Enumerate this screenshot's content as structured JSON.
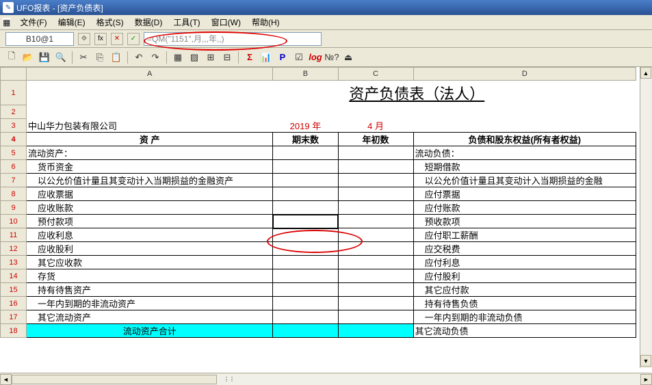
{
  "title": "UFO报表 - [资产负债表]",
  "menu": [
    "文件(F)",
    "编辑(E)",
    "格式(S)",
    "数据(D)",
    "工具(T)",
    "窗口(W)",
    "帮助(H)"
  ],
  "cell_ref": "B10@1",
  "formula": "=QM(\"1151\",月,,,年,,)",
  "toolbar": {
    "sigma": "Σ",
    "p": "P",
    "log": "log",
    "help": "?"
  },
  "cols": [
    "A",
    "B",
    "C",
    "D"
  ],
  "sheet_title": "资产负债表（法人）",
  "row3": {
    "company": "中山华力包装有限公司",
    "year": "2019 年",
    "month": "4 月"
  },
  "row4": {
    "a": "资    产",
    "b": "期末数",
    "c": "年初数",
    "d": "负债和股东权益(所有者权益)"
  },
  "rows": [
    {
      "n": 5,
      "a": "流动资产：",
      "d": "流动负债：",
      "indent": 0
    },
    {
      "n": 6,
      "a": "货币资金",
      "d": "短期借款",
      "indent": 1
    },
    {
      "n": 7,
      "a": "以公允价值计量且其变动计入当期损益的金融资产",
      "d": "以公允价值计量且其变动计入当期损益的金融",
      "indent": 1
    },
    {
      "n": 8,
      "a": "应收票据",
      "d": "应付票据",
      "indent": 1
    },
    {
      "n": 9,
      "a": "应收账款",
      "d": "应付账款",
      "indent": 1
    },
    {
      "n": 10,
      "a": "预付款项",
      "d": "预收款项",
      "indent": 1,
      "selected": true
    },
    {
      "n": 11,
      "a": "应收利息",
      "d": "应付职工薪酬",
      "indent": 1
    },
    {
      "n": 12,
      "a": "应收股利",
      "d": "应交税费",
      "indent": 1
    },
    {
      "n": 13,
      "a": "其它应收款",
      "d": "应付利息",
      "indent": 1
    },
    {
      "n": 14,
      "a": "存货",
      "d": "应付股利",
      "indent": 1
    },
    {
      "n": 15,
      "a": "持有待售资产",
      "d": "其它应付款",
      "indent": 1
    },
    {
      "n": 16,
      "a": "一年内到期的非流动资产",
      "d": "持有待售负债",
      "indent": 1
    },
    {
      "n": 17,
      "a": "其它流动资产",
      "d": "一年内到期的非流动负债",
      "indent": 1
    },
    {
      "n": 18,
      "a": "流动资产合计",
      "d": "其它流动负债",
      "indent": 0,
      "cyan": true
    }
  ]
}
